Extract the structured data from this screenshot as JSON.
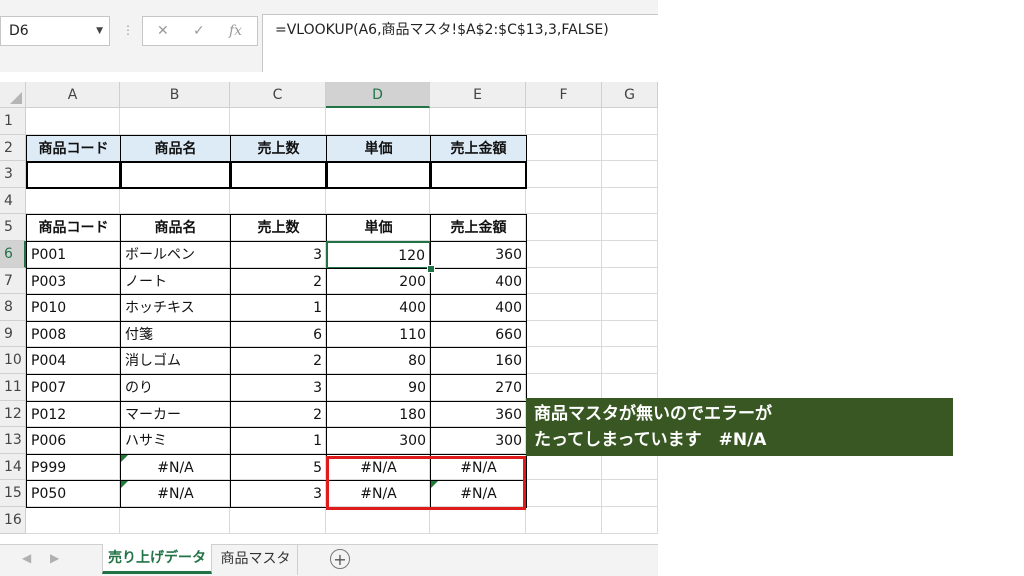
{
  "formula_bar": {
    "name_box": "D6",
    "cancel_icon": "✕",
    "enter_icon": "✓",
    "fx_label": "fx",
    "formula": "=VLOOKUP(A6,商品マスタ!$A$2:$C$13,3,FALSE)"
  },
  "columns": [
    "A",
    "B",
    "C",
    "D",
    "E",
    "F",
    "G"
  ],
  "rows": [
    "1",
    "2",
    "3",
    "4",
    "5",
    "6",
    "7",
    "8",
    "9",
    "10",
    "11",
    "12",
    "13",
    "14",
    "15",
    "16"
  ],
  "header_table": [
    "商品コード",
    "商品名",
    "売上数",
    "単価",
    "売上金額"
  ],
  "data_header": [
    "商品コード",
    "商品名",
    "売上数",
    "単価",
    "売上金額"
  ],
  "data_rows": [
    [
      "P001",
      "ボールペン",
      "3",
      "120",
      "360"
    ],
    [
      "P003",
      "ノート",
      "2",
      "200",
      "400"
    ],
    [
      "P010",
      "ホッチキス",
      "1",
      "400",
      "400"
    ],
    [
      "P008",
      "付箋",
      "6",
      "110",
      "660"
    ],
    [
      "P004",
      "消しゴム",
      "2",
      "80",
      "160"
    ],
    [
      "P007",
      "のり",
      "3",
      "90",
      "270"
    ],
    [
      "P012",
      "マーカー",
      "2",
      "180",
      "360"
    ],
    [
      "P006",
      "ハサミ",
      "1",
      "300",
      "300"
    ],
    [
      "P999",
      "#N/A",
      "5",
      "#N/A",
      "#N/A"
    ],
    [
      "P050",
      "#N/A",
      "3",
      "#N/A",
      "#N/A"
    ]
  ],
  "tabs": [
    "売り上げデータ",
    "商品マスタ"
  ],
  "callout": {
    "line1": "商品マスタが無いのでエラーが",
    "line2": "たってしまっています　#N/A"
  },
  "colors": {
    "header_fill": "#ddebf7",
    "callout_bg": "#385723",
    "error_box": "#e01b1b",
    "active_green": "#217346"
  }
}
